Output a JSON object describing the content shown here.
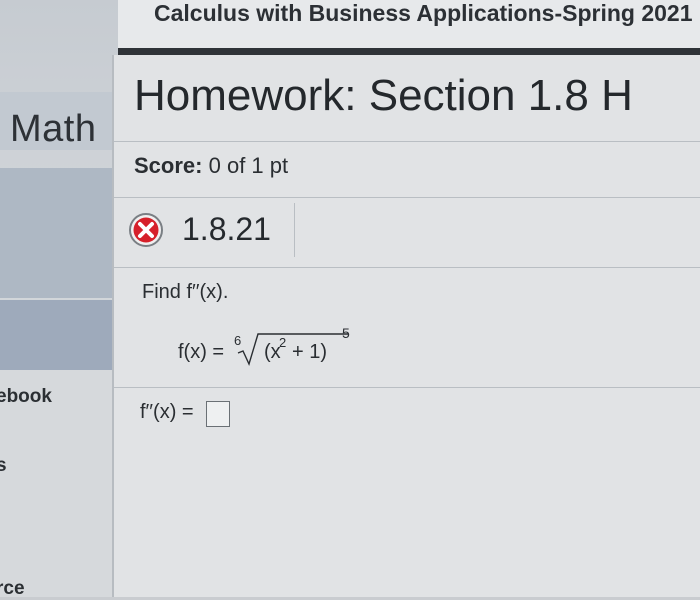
{
  "header": {
    "course_title": "Calculus with Business Applications-Spring 2021"
  },
  "sidebar": {
    "brand": "Math",
    "items": [
      {
        "label": "ebook"
      },
      {
        "label": "s"
      },
      {
        "label": "rce"
      }
    ]
  },
  "assignment": {
    "title": "Homework: Section 1.8 H",
    "score_label": "Score:",
    "score_value": "0 of 1 pt",
    "question_number": "1.8.21",
    "status_icon": "incorrect-x-icon"
  },
  "question": {
    "prompt": "Find f′′(x).",
    "function_lhs": "f(x) =",
    "root_index": "6",
    "inner_open": "(x",
    "inner_power": "2",
    "inner_close": "+ 1)",
    "outer_exponent": "5",
    "answer_label": "f′′(x) =",
    "answer_value": ""
  },
  "colors": {
    "error_red": "#d6202a",
    "rule_dark": "#2f3338"
  }
}
